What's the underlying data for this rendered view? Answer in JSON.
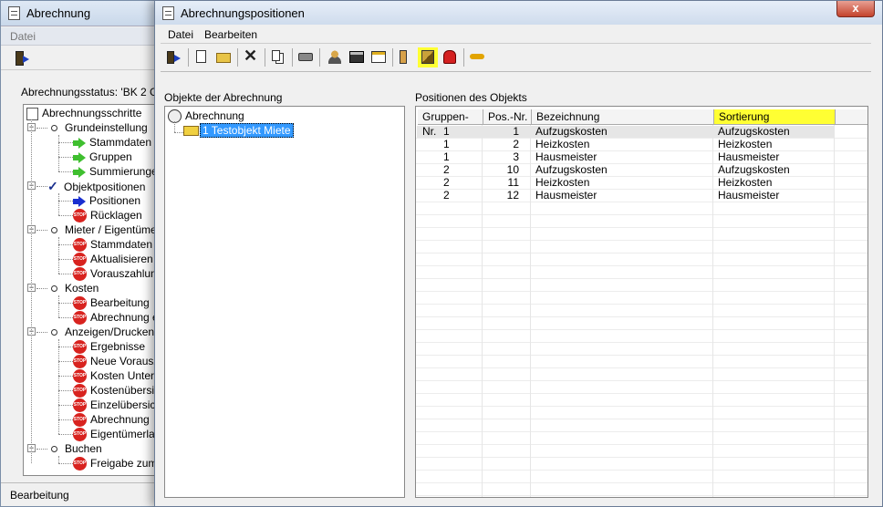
{
  "back_window": {
    "title": "Abrechnung",
    "menu": [
      "Datei"
    ],
    "status_label": "Abrechnungsstatus: 'BK 2 Grup",
    "statusbar": "Bearbeitung",
    "tree": {
      "root": "Abrechnungsschritte",
      "groups": [
        {
          "label": "Grundeinstellung",
          "icon": "ring-icon",
          "items": [
            {
              "label": "Stammdaten",
              "icon": "green-arrow-icon"
            },
            {
              "label": "Gruppen",
              "icon": "green-arrow-icon"
            },
            {
              "label": "Summierungen",
              "icon": "green-arrow-icon"
            }
          ]
        },
        {
          "label": "Objektpositionen",
          "icon": "checkmark-icon",
          "items": [
            {
              "label": "Positionen",
              "icon": "blue-arrow-icon"
            },
            {
              "label": "Rücklagen",
              "icon": "stop-icon"
            }
          ]
        },
        {
          "label": "Mieter / Eigentümer",
          "icon": "ring-icon",
          "items": [
            {
              "label": "Stammdaten",
              "icon": "stop-icon"
            },
            {
              "label": "Aktualisieren u",
              "icon": "stop-icon"
            },
            {
              "label": "Vorauszahlung",
              "icon": "stop-icon"
            }
          ]
        },
        {
          "label": "Kosten",
          "icon": "ring-icon",
          "items": [
            {
              "label": "Bearbeitung",
              "icon": "stop-icon"
            },
            {
              "label": "Abrechnung e",
              "icon": "stop-icon"
            }
          ]
        },
        {
          "label": "Anzeigen/Drucken",
          "icon": "ring-icon",
          "items": [
            {
              "label": "Ergebnisse",
              "icon": "stop-icon"
            },
            {
              "label": "Neue Vorausz",
              "icon": "stop-icon"
            },
            {
              "label": "Kosten Unter-/",
              "icon": "stop-icon"
            },
            {
              "label": "Kostenübersic",
              "icon": "stop-icon"
            },
            {
              "label": "Einzelübersich",
              "icon": "stop-icon"
            },
            {
              "label": "Abrechnung",
              "icon": "stop-icon"
            },
            {
              "label": "Eigentümerlas",
              "icon": "stop-icon"
            }
          ]
        },
        {
          "label": "Buchen",
          "icon": "ring-icon",
          "items": [
            {
              "label": "Freigabe zum",
              "icon": "stop-icon"
            }
          ]
        }
      ]
    }
  },
  "front_window": {
    "title": "Abrechnungspositionen",
    "close_label": "x",
    "menu": [
      "Datei",
      "Bearbeiten"
    ],
    "stop_text": "STOP",
    "highlight_color": "#ffff33",
    "objects_panel": {
      "label": "Objekte der Abrechnung",
      "root": "Abrechnung",
      "child": "1 Testobjekt Miete"
    },
    "positions_panel": {
      "label": "Positionen des Objekts",
      "columns": [
        "Gruppen-Nr.",
        "Pos.-Nr.",
        "Bezeichnung",
        "Sortierung"
      ],
      "rows": [
        [
          "1",
          "1",
          "Aufzugskosten",
          "Aufzugskosten"
        ],
        [
          "1",
          "2",
          "Heizkosten",
          "Heizkosten"
        ],
        [
          "1",
          "3",
          "Hausmeister",
          "Hausmeister"
        ],
        [
          "2",
          "10",
          "Aufzugskosten",
          "Aufzugskosten"
        ],
        [
          "2",
          "11",
          "Heizkosten",
          "Heizkosten"
        ],
        [
          "2",
          "12",
          "Hausmeister",
          "Hausmeister"
        ]
      ]
    }
  }
}
